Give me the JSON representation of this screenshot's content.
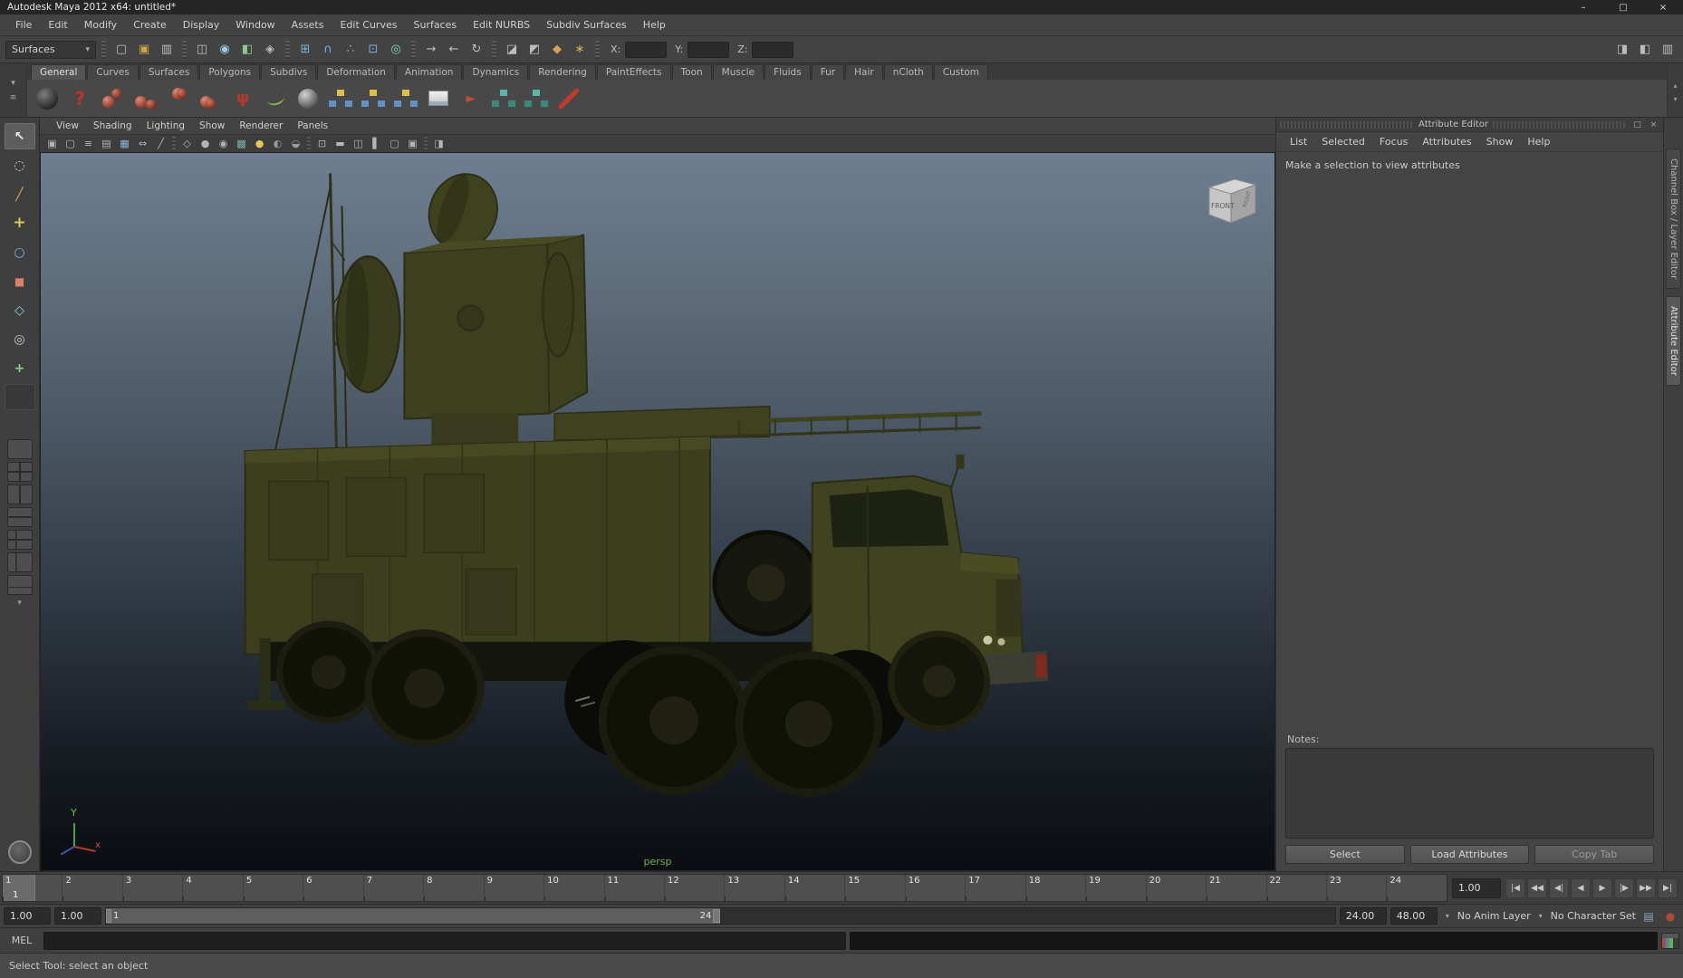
{
  "window": {
    "title": "Autodesk Maya 2012 x64: untitled*",
    "controls": {
      "minimize": "–",
      "maximize": "□",
      "close": "×"
    }
  },
  "menu_bar": {
    "items": [
      "File",
      "Edit",
      "Modify",
      "Create",
      "Display",
      "Window",
      "Assets",
      "Edit Curves",
      "Surfaces",
      "Edit NURBS",
      "Subdiv Surfaces",
      "Help"
    ]
  },
  "status_line": {
    "menuset": "Surfaces",
    "dropdown_icon": "▾",
    "x_label": "X:",
    "y_label": "Y:",
    "z_label": "Z:",
    "x_value": "",
    "y_value": "",
    "z_value": ""
  },
  "shelf": {
    "tabs": [
      "General",
      "Curves",
      "Surfaces",
      "Polygons",
      "Subdivs",
      "Deformation",
      "Animation",
      "Dynamics",
      "Rendering",
      "PaintEffects",
      "Toon",
      "Muscle",
      "Fluids",
      "Fur",
      "Hair",
      "nCloth",
      "Custom"
    ],
    "active_tab": "General"
  },
  "panel": {
    "menus": [
      "View",
      "Shading",
      "Lighting",
      "Show",
      "Renderer",
      "Panels"
    ],
    "camera_label": "persp",
    "view_cube": {
      "front_label": "FRONT",
      "right_label": "RIGHT"
    },
    "axis": {
      "x_label": "x",
      "y_label": "Y"
    }
  },
  "attribute_editor": {
    "title": "Attribute Editor",
    "float_icon": "□",
    "close_icon": "×",
    "menus": [
      "List",
      "Selected",
      "Focus",
      "Attributes",
      "Show",
      "Help"
    ],
    "message": "Make a selection to view attributes",
    "notes_label": "Notes:",
    "select_button": "Select",
    "load_attributes_button": "Load Attributes",
    "copy_tab_button": "Copy Tab"
  },
  "side_tabs": {
    "channel_box": "Channel Box / Layer Editor",
    "attribute_editor": "Attribute Editor"
  },
  "timeline": {
    "ticks": [
      "1",
      "2",
      "3",
      "4",
      "5",
      "6",
      "7",
      "8",
      "9",
      "10",
      "11",
      "12",
      "13",
      "14",
      "15",
      "16",
      "17",
      "18",
      "19",
      "20",
      "21",
      "22",
      "23",
      "24"
    ],
    "current_frame": "1",
    "current_time": "1.00",
    "playback": [
      "|◀",
      "◀◀",
      "◀|",
      "◀",
      "▶",
      "|▶",
      "▶▶",
      "▶|"
    ]
  },
  "range_slider": {
    "animation_start": "1.00",
    "playback_start": "1.00",
    "range_start": "1",
    "range_end": "24",
    "playback_end": "24.00",
    "animation_end": "48.00",
    "dropdown_icon": "▾",
    "anim_layer": "No Anim Layer",
    "character_set": "No Character Set"
  },
  "command_line": {
    "label": "MEL",
    "input_value": "",
    "output_value": ""
  },
  "help_line": {
    "message": "Select Tool: select an object"
  },
  "colors": {
    "ui_background": "#434343",
    "viewport_gradient_top": "#6e7e90",
    "viewport_gradient_bottom": "#0a0e13",
    "truck_body": "#3c3f1e",
    "camera_label": "#76b041"
  }
}
